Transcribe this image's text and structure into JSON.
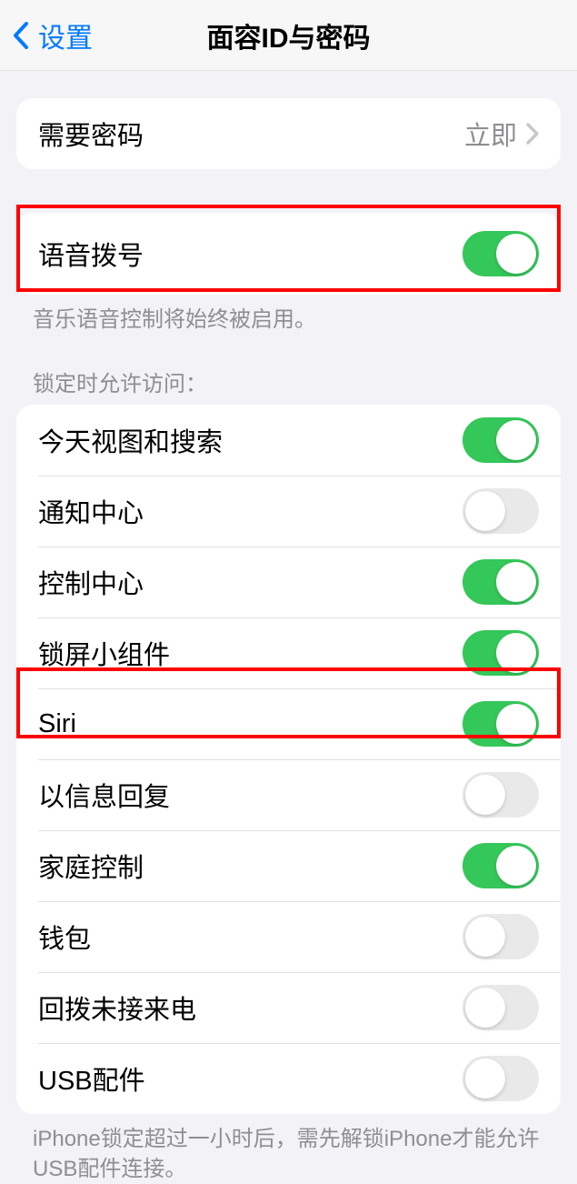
{
  "nav": {
    "back_label": "设置",
    "title": "面容ID与密码"
  },
  "require_passcode": {
    "label": "需要密码",
    "value": "立即"
  },
  "voice_dial": {
    "label": "语音拨号",
    "on": true,
    "footer": "音乐语音控制将始终被启用。"
  },
  "lock_access": {
    "header": "锁定时允许访问：",
    "items": [
      {
        "label": "今天视图和搜索",
        "on": true
      },
      {
        "label": "通知中心",
        "on": false
      },
      {
        "label": "控制中心",
        "on": true
      },
      {
        "label": "锁屏小组件",
        "on": true
      },
      {
        "label": "Siri",
        "on": true
      },
      {
        "label": "以信息回复",
        "on": false
      },
      {
        "label": "家庭控制",
        "on": true
      },
      {
        "label": "钱包",
        "on": false
      },
      {
        "label": "回拨未接来电",
        "on": false
      },
      {
        "label": "USB配件",
        "on": false
      }
    ],
    "footer": "iPhone锁定超过一小时后，需先解锁iPhone才能允许USB配件连接。"
  }
}
